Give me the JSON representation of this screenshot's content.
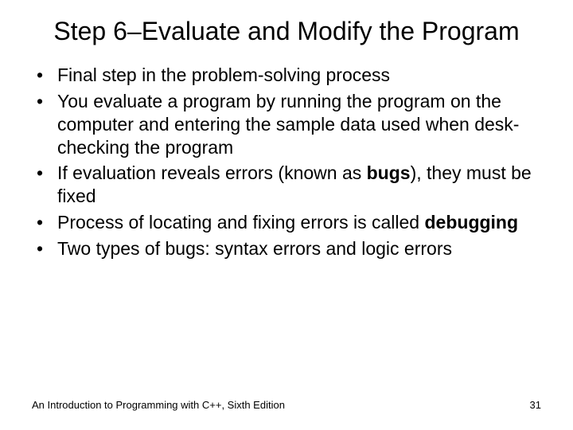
{
  "title": "Step 6–Evaluate and Modify the Program",
  "bullets": [
    {
      "html": "Final step in the problem-solving process"
    },
    {
      "html": "You evaluate a program by running the program on the computer and entering the sample data used when desk-checking the program"
    },
    {
      "html": "If evaluation reveals errors (known as <b>bugs</b>), they must be fixed"
    },
    {
      "html": "Process of locating and fixing errors is called <b>debugging</b>"
    },
    {
      "html": "Two types of bugs: syntax errors and logic errors"
    }
  ],
  "footer": {
    "text": "An Introduction to Programming with C++, Sixth Edition",
    "page": "31"
  }
}
